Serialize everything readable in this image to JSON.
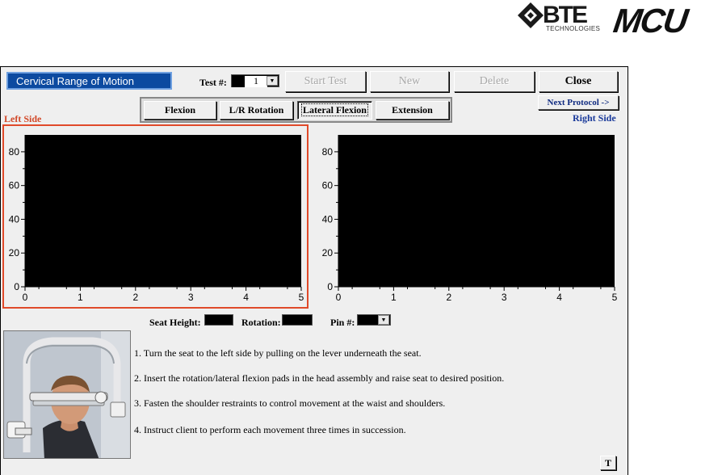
{
  "logos": {
    "bte_text": "BTE",
    "bte_sub": "TECHNOLOGIES",
    "mcu_text": "MCU"
  },
  "window": {
    "title": "Cervical Range of Motion",
    "test_label": "Test #:",
    "test_value": "1",
    "buttons": {
      "start_test": "Start Test",
      "new": "New",
      "delete": "Delete",
      "close": "Close"
    },
    "tabs": [
      {
        "label": "Flexion",
        "active": false
      },
      {
        "label": "L/R Rotation",
        "active": false
      },
      {
        "label": "Lateral Flexion",
        "active": true
      },
      {
        "label": "Extension",
        "active": false
      }
    ],
    "next_protocol": "Next Protocol ->",
    "left_side": "Left Side",
    "right_side": "Right Side",
    "fields": {
      "seat_height_label": "Seat Height:",
      "rotation_label": "Rotation:",
      "pin_label": "Pin #:"
    },
    "instructions": [
      "1.  Turn the seat to the left side by pulling on the lever underneath the seat.",
      "2.  Insert the rotation/lateral flexion pads in the head assembly and raise seat to desired position.",
      "3.  Fasten the shoulder restraints to control movement at the waist and shoulders.",
      "4.  Instruct client to perform each movement three times in succession."
    ],
    "t_button": "T"
  },
  "colors": {
    "title_bg": "#0c4aa0",
    "left_side_text": "#d24a2a",
    "right_side_text": "#1a3a9a",
    "highlight_border": "#e04a2a",
    "chart_bg": "#000000"
  },
  "chart_data": [
    {
      "type": "line",
      "x_ticks": [
        "0",
        "1",
        "2",
        "3",
        "4",
        "5"
      ],
      "y_ticks": [
        "0",
        "20",
        "40",
        "60",
        "80"
      ],
      "xlim": [
        0,
        5
      ],
      "ylim": [
        0,
        90
      ],
      "series": []
    },
    {
      "type": "line",
      "x_ticks": [
        "0",
        "1",
        "2",
        "3",
        "4",
        "5"
      ],
      "y_ticks": [
        "0",
        "20",
        "40",
        "60",
        "80"
      ],
      "xlim": [
        0,
        5
      ],
      "ylim": [
        0,
        90
      ],
      "series": []
    }
  ]
}
